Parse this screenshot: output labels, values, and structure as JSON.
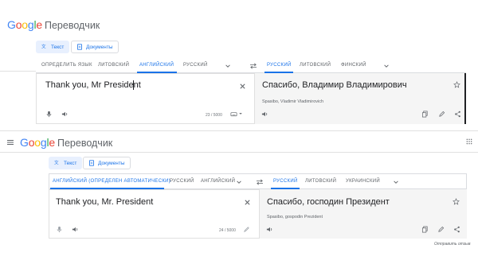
{
  "top": {
    "logo": {
      "google": "Google",
      "product": "Переводчик"
    },
    "modes": {
      "text": "Текст",
      "documents": "Документы"
    },
    "source_langs": [
      "ОПРЕДЕЛИТЬ ЯЗЫК",
      "ЛИТОВСКИЙ",
      "АНГЛИЙСКИЙ",
      "РУССКИЙ"
    ],
    "target_langs": [
      "РУССКИЙ",
      "ЛИТОВСКИЙ",
      "ФИНСКИЙ"
    ],
    "source_text": "Thank you, Mr President",
    "char_count": "23 / 5000",
    "translation": "Спасибо, Владимир Владимирович",
    "transliteration": "Spasibo, Vladimir Vladimirovich"
  },
  "bottom": {
    "logo": {
      "google": "Google",
      "product": "Переводчик"
    },
    "modes": {
      "text": "Текст",
      "documents": "Документы"
    },
    "source_langs": [
      "АНГЛИЙСКИЙ (ОПРЕДЕЛЕН АВТОМАТИЧЕСКИ)",
      "РУССКИЙ",
      "АНГЛИЙСКИЙ"
    ],
    "target_langs": [
      "РУССКИЙ",
      "ЛИТОВСКИЙ",
      "УКРАИНСКИЙ"
    ],
    "source_text": "Thank you, Mr. President",
    "char_count": "24 / 5000",
    "translation": "Спасибо, господин Президент",
    "transliteration": "Spasibo, gospodin Prezident",
    "feedback": "Отправить отзыв"
  },
  "colors": {
    "accent": "#1a73e8",
    "target_bg": "#f5f5f5",
    "border": "#dadce0"
  }
}
